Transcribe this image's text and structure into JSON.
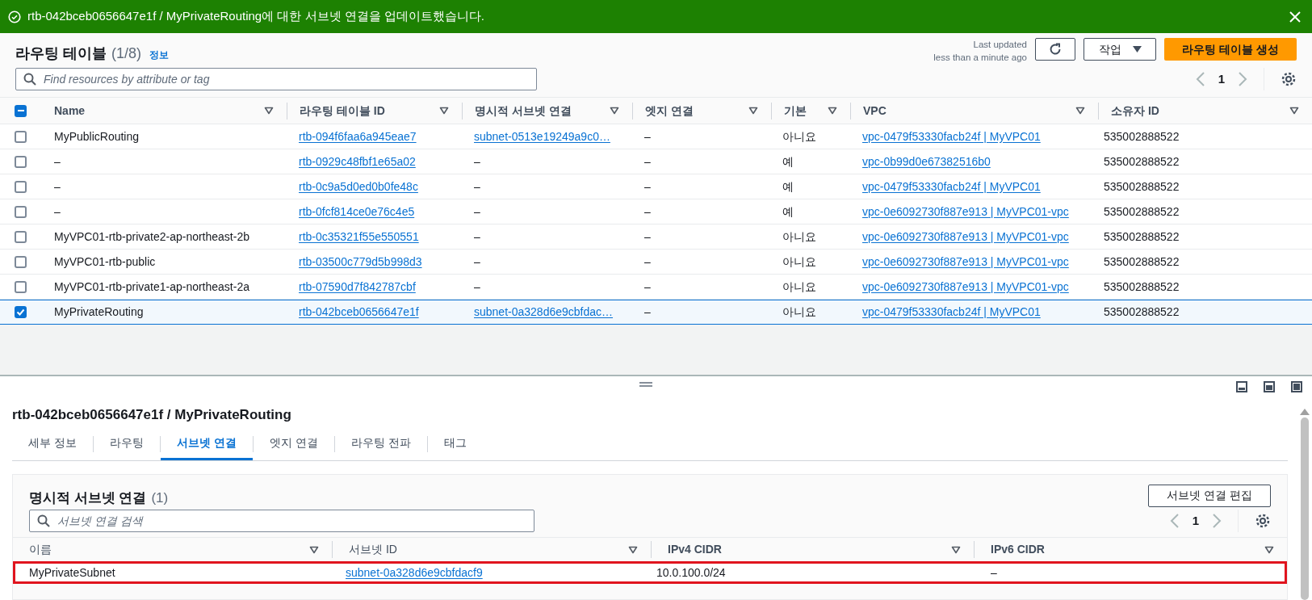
{
  "banner": {
    "message": "rtb-042bceb0656647e1f / MyPrivateRouting에 대한 서브넷 연결을 업데이트했습니다."
  },
  "header": {
    "title": "라우팅 테이블",
    "count": "(1/8)",
    "info_link": "정보",
    "last_updated": [
      "Last updated",
      "less than a minute ago"
    ],
    "actions_button": "작업",
    "create_button": "라우팅 테이블 생성"
  },
  "search": {
    "placeholder": "Find resources by attribute or tag"
  },
  "pagination": {
    "page": "1"
  },
  "table": {
    "select_all_indeterminate": true,
    "columns": [
      "Name",
      "라우팅 테이블 ID",
      "명시적 서브넷 연결",
      "엣지 연결",
      "기본",
      "VPC",
      "소유자 ID"
    ],
    "rows": [
      {
        "selected": false,
        "name": "MyPublicRouting",
        "id": "rtb-094f6faa6a945eae7",
        "subnet": "subnet-0513e19249a9c0…",
        "subnet_link": true,
        "edge": "–",
        "main": "아니요",
        "vpc": "vpc-0479f53330facb24f | MyVPC01",
        "owner": "535002888522"
      },
      {
        "selected": false,
        "name": "–",
        "id": "rtb-0929c48fbf1e65a02",
        "subnet": "–",
        "subnet_link": false,
        "edge": "–",
        "main": "예",
        "vpc": "vpc-0b99d0e67382516b0",
        "owner": "535002888522"
      },
      {
        "selected": false,
        "name": "–",
        "id": "rtb-0c9a5d0ed0b0fe48c",
        "subnet": "–",
        "subnet_link": false,
        "edge": "–",
        "main": "예",
        "vpc": "vpc-0479f53330facb24f | MyVPC01",
        "owner": "535002888522"
      },
      {
        "selected": false,
        "name": "–",
        "id": "rtb-0fcf814ce0e76c4e5",
        "subnet": "–",
        "subnet_link": false,
        "edge": "–",
        "main": "예",
        "vpc": "vpc-0e6092730f887e913 | MyVPC01-vpc",
        "owner": "535002888522"
      },
      {
        "selected": false,
        "name": "MyVPC01-rtb-private2-ap-northeast-2b",
        "id": "rtb-0c35321f55e550551",
        "subnet": "–",
        "subnet_link": false,
        "edge": "–",
        "main": "아니요",
        "vpc": "vpc-0e6092730f887e913 | MyVPC01-vpc",
        "owner": "535002888522"
      },
      {
        "selected": false,
        "name": "MyVPC01-rtb-public",
        "id": "rtb-03500c779d5b998d3",
        "subnet": "–",
        "subnet_link": false,
        "edge": "–",
        "main": "아니요",
        "vpc": "vpc-0e6092730f887e913 | MyVPC01-vpc",
        "owner": "535002888522"
      },
      {
        "selected": false,
        "name": "MyVPC01-rtb-private1-ap-northeast-2a",
        "id": "rtb-07590d7f842787cbf",
        "subnet": "–",
        "subnet_link": false,
        "edge": "–",
        "main": "아니요",
        "vpc": "vpc-0e6092730f887e913 | MyVPC01-vpc",
        "owner": "535002888522"
      },
      {
        "selected": true,
        "name": "MyPrivateRouting",
        "id": "rtb-042bceb0656647e1f",
        "subnet": "subnet-0a328d6e9cbfdac…",
        "subnet_link": true,
        "edge": "–",
        "main": "아니요",
        "vpc": "vpc-0479f53330facb24f | MyVPC01",
        "owner": "535002888522"
      }
    ]
  },
  "detail": {
    "title": "rtb-042bceb0656647e1f / MyPrivateRouting",
    "tabs": [
      {
        "label": "세부 정보",
        "selected": false
      },
      {
        "label": "라우팅",
        "selected": false
      },
      {
        "label": "서브넷 연결",
        "selected": true
      },
      {
        "label": "엣지 연결",
        "selected": false
      },
      {
        "label": "라우팅 전파",
        "selected": false
      },
      {
        "label": "태그",
        "selected": false
      }
    ],
    "card": {
      "title": "명시적 서브넷 연결",
      "count": "(1)",
      "edit_button": "서브넷 연결 편집",
      "search_placeholder": "서브넷 연결 검색",
      "page": "1",
      "columns": [
        "이름",
        "서브넷 ID",
        "IPv4 CIDR",
        "IPv6 CIDR"
      ],
      "rows": [
        {
          "highlighted": true,
          "name": "MyPrivateSubnet",
          "subnet_id": "subnet-0a328d6e9cbfdacf9",
          "ipv4": "10.0.100.0/24",
          "ipv6": "–"
        }
      ]
    }
  }
}
